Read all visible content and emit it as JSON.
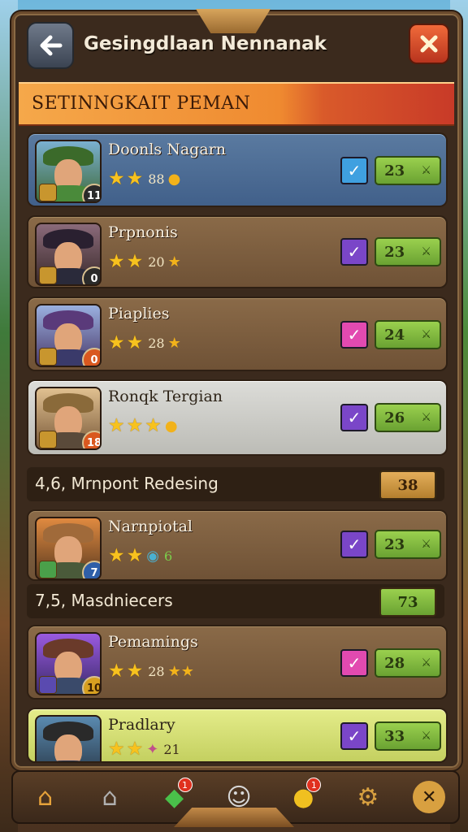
{
  "header": {
    "title": "Gesingdlaan  Nennanak",
    "back_icon": "arrow-left-icon",
    "close_icon": "close-icon"
  },
  "banner": {
    "label": "SETINNGKAIT PEMAN"
  },
  "players": [
    {
      "name": "Doonls Nagarn",
      "level": "11",
      "stars": 2,
      "stat": "88",
      "check": "blue",
      "score": "23",
      "style": "blue"
    },
    {
      "name": "Prpnonis",
      "level": "0",
      "stars": 2,
      "stat": "20",
      "check": "purple",
      "score": "23",
      "style": "brown"
    },
    {
      "name": "Piaplies",
      "level": "0",
      "stars": 2,
      "stat": "28",
      "check": "pink",
      "score": "24",
      "style": "brown"
    },
    {
      "name": "Ronqk Tergian",
      "level": "18",
      "stars": 3,
      "stat": "",
      "check": "purple",
      "score": "26",
      "style": "light"
    }
  ],
  "section1": {
    "label": "4,6, Mrnpont Redesing",
    "value": "38"
  },
  "player5": {
    "name": "Narnpiotal",
    "level": "7",
    "stars": 2,
    "stat": "6",
    "check": "purple",
    "score": "23"
  },
  "section2": {
    "label": "7,5, Masdniecers",
    "value": "73"
  },
  "player6": {
    "name": "Pemamings",
    "level": "10",
    "stars": 2,
    "stat": "28",
    "check": "pink",
    "score": "28"
  },
  "player7": {
    "name": "Pradlary",
    "level": "",
    "stars": 2,
    "stat": "21",
    "check": "purple",
    "score": "33"
  },
  "nav": [
    {
      "icon": "home-icon",
      "badge": ""
    },
    {
      "icon": "house-icon",
      "badge": ""
    },
    {
      "icon": "gem-icon",
      "badge": "1"
    },
    {
      "icon": "mask-icon",
      "badge": ""
    },
    {
      "icon": "coin-icon",
      "badge": "1"
    },
    {
      "icon": "gear-icon",
      "badge": ""
    },
    {
      "icon": "tools-icon",
      "badge": ""
    }
  ],
  "colors": {
    "score_green": "#8cc63f",
    "banner_orange": "#ef8a30",
    "check_purple": "#7a46c8",
    "check_pink": "#e24ab0",
    "check_blue": "#3fa0e0"
  }
}
